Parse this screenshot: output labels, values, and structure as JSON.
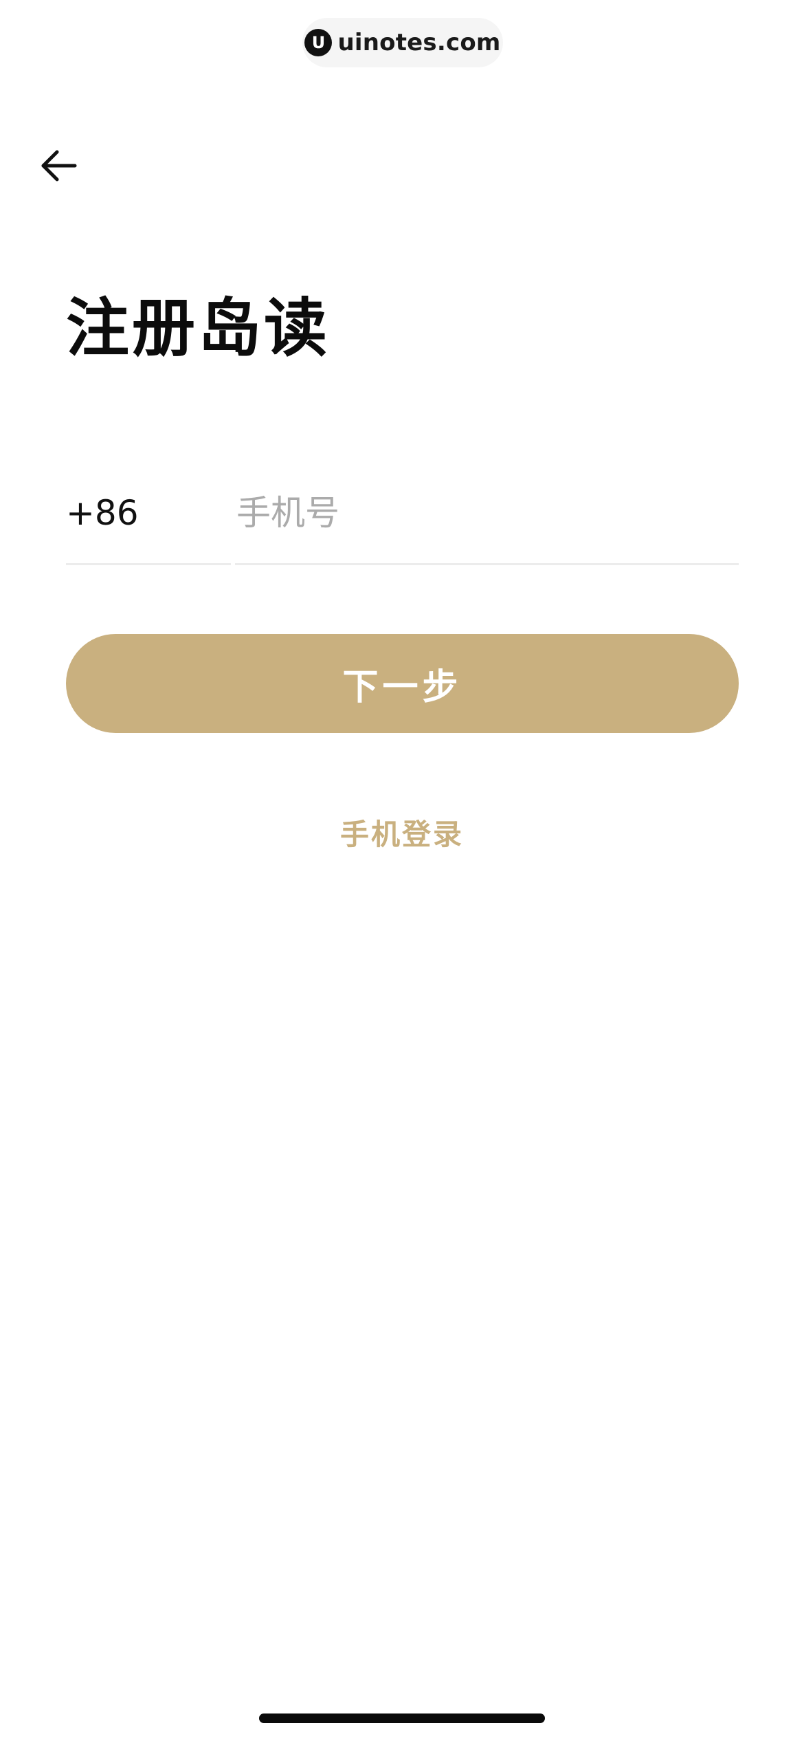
{
  "watermark": {
    "logo_glyph": "U",
    "text": "uinotes.com"
  },
  "header": {
    "back_icon": "arrow-left-icon"
  },
  "title": "注册岛读",
  "form": {
    "country_code": "+86",
    "phone_value": "",
    "phone_placeholder": "手机号",
    "next_label": "下一步"
  },
  "alt_login": {
    "label": "手机登录"
  },
  "colors": {
    "accent": "#c9b07f",
    "title": "#0c0c0c",
    "placeholder": "#ababab",
    "divider": "#ececec"
  }
}
